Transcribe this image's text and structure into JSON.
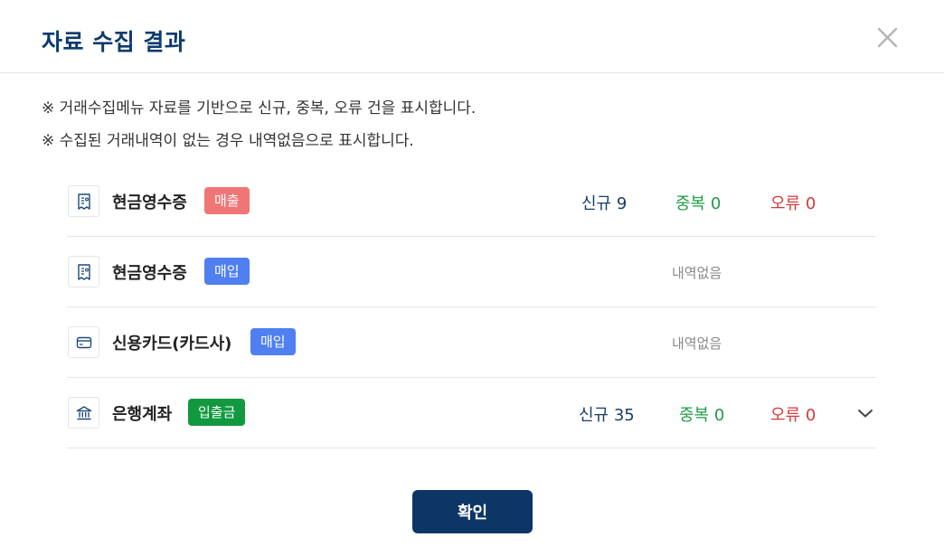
{
  "dialog": {
    "title": "자료 수집 결과",
    "close_icon": "close-icon",
    "notes": [
      "※ 거래수집메뉴 자료를 기반으로 신규, 중복, 오류 건을 표시합니다.",
      "※ 수집된 거래내역이 없는 경우 내역없음으로 표시합니다."
    ],
    "rows": [
      {
        "icon": "receipt-icon",
        "label": "현금영수증",
        "badge": "매출",
        "badge_color": "#f07676",
        "new": "신규 9",
        "dup": "중복 0",
        "err": "오류 0"
      },
      {
        "icon": "receipt-icon",
        "label": "현금영수증",
        "badge": "매입",
        "badge_color": "#4f7ff0",
        "empty": "내역없음"
      },
      {
        "icon": "credit-card-icon",
        "label": "신용카드(카드사)",
        "badge": "매입",
        "badge_color": "#4f7ff0",
        "empty": "내역없음"
      },
      {
        "icon": "bank-icon",
        "label": "은행계좌",
        "badge": "입출금",
        "badge_color": "#11993f",
        "new": "신규 35",
        "dup": "중복 0",
        "err": "오류 0",
        "expand_icon": "chevron-down-icon"
      }
    ],
    "confirm_label": "확인",
    "colors": {
      "title": "#0d3a6e",
      "new": "#1a3d66",
      "duplicate": "#1e9b45",
      "error": "#d43a3a",
      "confirm_button": "#0d3566"
    }
  }
}
